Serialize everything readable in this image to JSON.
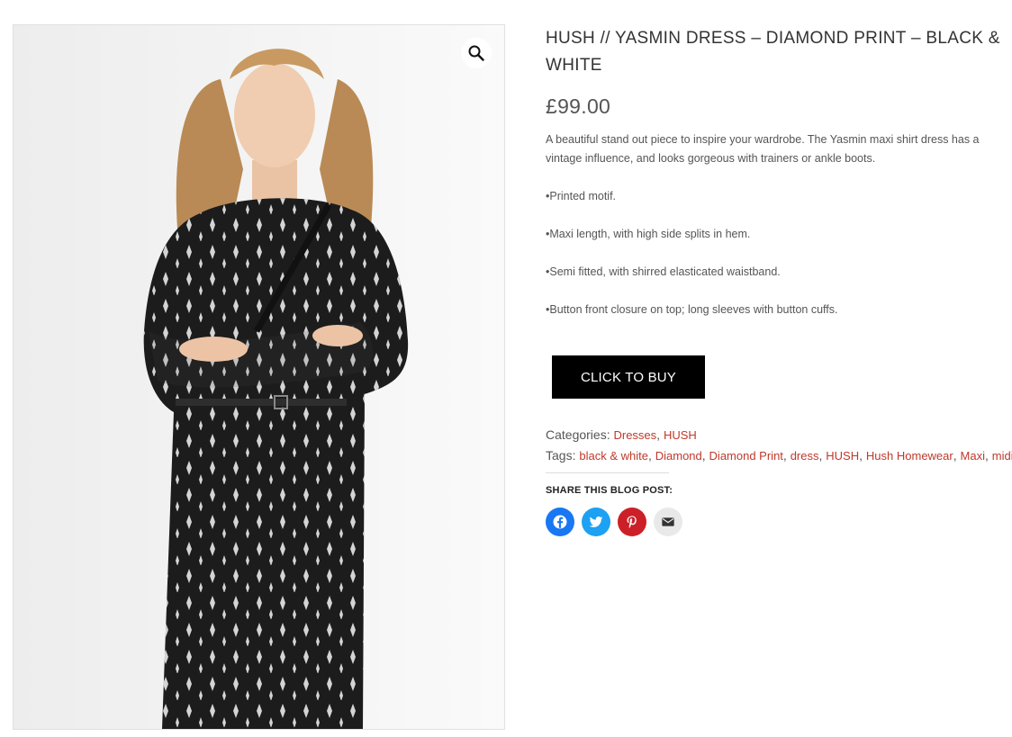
{
  "product": {
    "title": "HUSH // YASMIN DRESS – DIAMOND PRINT – BLACK & WHITE",
    "price": "£99.00",
    "description": "A beautiful stand out piece to inspire your wardrobe. The Yasmin maxi shirt dress has a vintage influence, and looks gorgeous with trainers or ankle boots.",
    "bullets": [
      "•Printed motif.",
      "•Maxi length, with high side splits in hem.",
      "•Semi fitted, with shirred elasticated waistband.",
      "•Button front closure on top; long sleeves with button cuffs."
    ],
    "buy_label": "CLICK TO BUY"
  },
  "gallery": {
    "zoom_icon": "magnifier-icon"
  },
  "meta": {
    "categories_label": "Categories:",
    "categories": [
      "Dresses",
      "HUSH"
    ],
    "tags_label": "Tags:",
    "tags": [
      "black & white",
      "Diamond",
      "Diamond Print",
      "dress",
      "HUSH",
      "Hush Homewear",
      "Maxi",
      "midi"
    ]
  },
  "share": {
    "label": "SHARE THIS BLOG POST:",
    "buttons": [
      {
        "name": "facebook",
        "icon": "facebook-icon",
        "color": "#1877f2"
      },
      {
        "name": "twitter",
        "icon": "twitter-icon",
        "color": "#1da1f2"
      },
      {
        "name": "pinterest",
        "icon": "pinterest-icon",
        "color": "#cb2027"
      },
      {
        "name": "email",
        "icon": "email-icon",
        "color": "#e9e9e9"
      }
    ]
  },
  "colors": {
    "link": "#c0392b",
    "button_bg": "#000000",
    "button_text": "#ffffff"
  }
}
